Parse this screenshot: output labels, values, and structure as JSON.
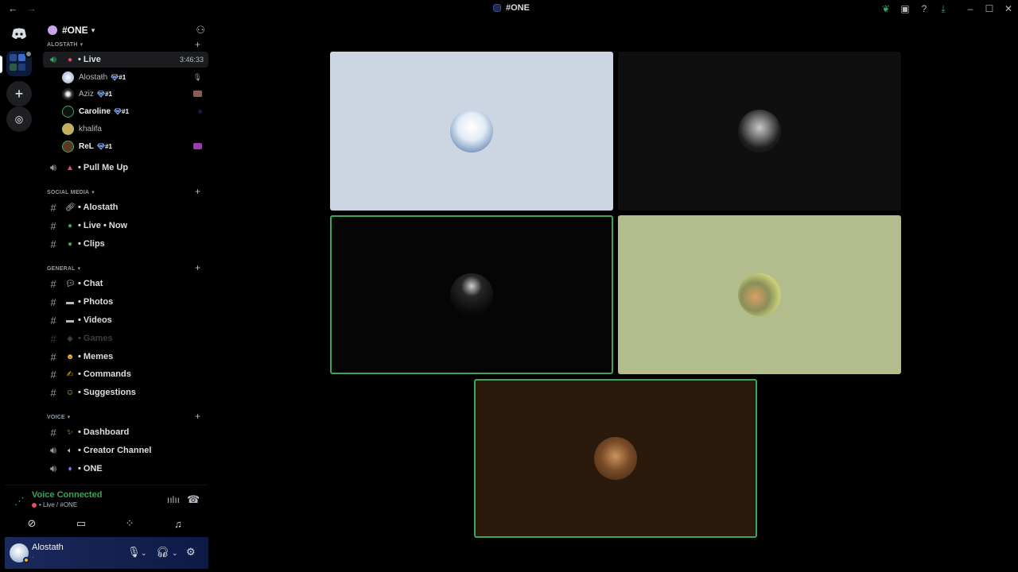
{
  "window": {
    "title": "#ONE"
  },
  "server": {
    "name": "#ONE"
  },
  "categories": {
    "alostath": "ALOSTATH",
    "social_media": "SOCIAL MEDIA",
    "general": "GENERAL",
    "voice": "VOICE"
  },
  "live_channel": {
    "name": "• Live",
    "timer": "3:46:33"
  },
  "voice_users": [
    {
      "name": "Alostaŧh",
      "tag": "#1"
    },
    {
      "name": "Aziz",
      "tag": "#1"
    },
    {
      "name": "Caroline",
      "tag": "#1"
    },
    {
      "name": "khalifa",
      "tag": ""
    },
    {
      "name": "ReL",
      "tag": "#1"
    }
  ],
  "channels": {
    "pull_me_up": "• Pull Me Up",
    "alostath": "• Alostath",
    "live_now": "• Live • Now",
    "clips": "• Clips",
    "chat": "• Chat",
    "photos": "• Photos",
    "videos": "• Videos",
    "games": "• Games",
    "memes": "• Memes",
    "commands": "• Commands",
    "suggestions": "• Suggestions",
    "dashboard": "• Dashboard",
    "creator_channel": "•  Creator Channel",
    "one": "• ONE"
  },
  "voice_panel": {
    "status": "Voice Connected",
    "location": "• Live / #ONE"
  },
  "user_panel": {
    "name": "Alostaŧh",
    "status_line": "·"
  },
  "icons": {
    "discord": "discord-logo-icon",
    "server_add": "add-server-icon",
    "explore": "compass-icon",
    "invite": "add-member-icon",
    "mic": "microphone-icon",
    "headset": "headphones-icon",
    "settings": "gear-icon"
  },
  "colors": {
    "voice_connected": "#3ba55d",
    "speaking_border": "#3ba55d",
    "live_dot": "#e84a5f",
    "user_panel_bg": "#1a2a5c"
  }
}
